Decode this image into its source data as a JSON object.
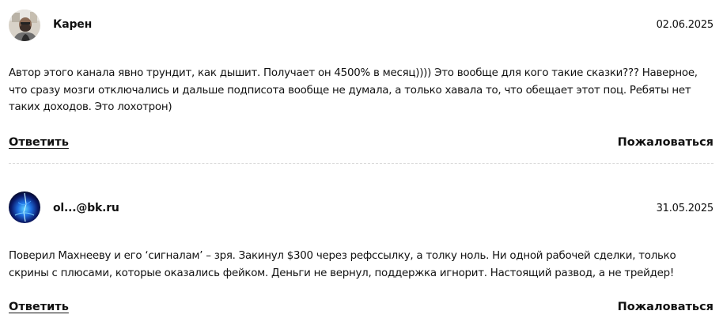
{
  "comments": [
    {
      "author": "Карен",
      "date": "02.06.2025",
      "text": "Автор этого канала явно трундит, как дышит. Получает он 4500% в месяц)))) Это вообще для кого такие сказки??? Наверное, что сразу мозги отключались и дальше подписота вообще не думала, а только хавала то, что обещает этот поц. Ребяты нет таких доходов. Это лохотрон)",
      "reply_label": "Ответить",
      "report_label": "Пожаловаться",
      "avatar_icon": "user-photo-icon"
    },
    {
      "author": "ol...@bk.ru",
      "date": "31.05.2025",
      "text": "Поверил Махнееву и его ‘сигналам’ – зря. Закинул $300 через рефссылку, а толку ноль. Ни одной рабочей сделки, только скрины с плюсами, которые оказались фейком. Деньги не вернул, поддержка игнорит. Настоящий развод, а не трейдер!",
      "reply_label": "Ответить",
      "report_label": "Пожаловаться",
      "avatar_icon": "blue-abstract-avatar-icon"
    }
  ],
  "colors": {
    "text": "#111111",
    "divider": "#d9d9d9",
    "background": "#ffffff"
  }
}
